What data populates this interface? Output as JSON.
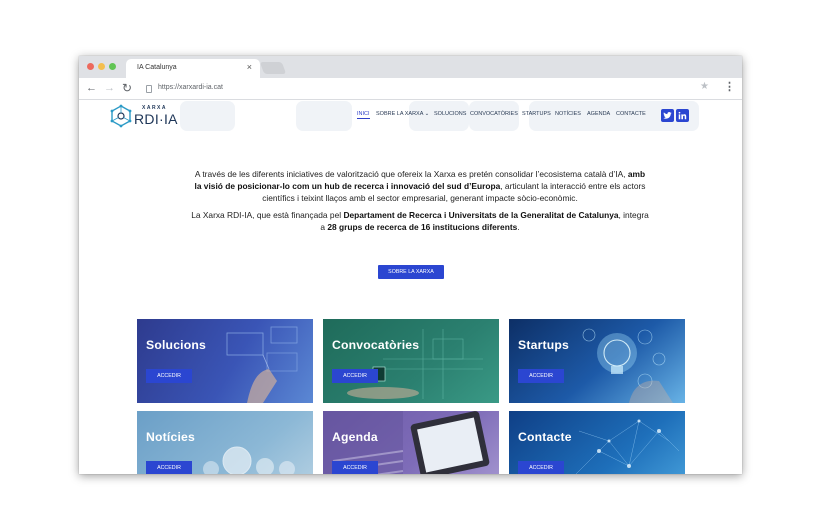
{
  "browser": {
    "tab_title": "IA Catalunya",
    "tab_close": "×",
    "url": "https://xarxardi-ia.cat",
    "back_icon": "arrow-left-icon",
    "forward_icon": "arrow-right-icon",
    "reload_icon": "reload-icon",
    "star_icon": "star-icon",
    "menu_icon": "kebab-menu-icon",
    "back_glyph": "←",
    "forward_glyph": "→",
    "reload_glyph": "↻",
    "star_glyph": "★",
    "menu_glyph": "⋮"
  },
  "site": {
    "logo": {
      "small": "XARXA",
      "big": "RDI·IA"
    },
    "nav": {
      "items": [
        {
          "label": "Inici",
          "active": true
        },
        {
          "label": "Sobre la Xarxa ⌄",
          "active": false
        },
        {
          "label": "Solucions",
          "active": false
        },
        {
          "label": "Convocatòries",
          "active": false
        },
        {
          "label": "Startups",
          "active": false
        },
        {
          "label": "Notícies",
          "active": false
        },
        {
          "label": "Agenda",
          "active": false
        },
        {
          "label": "Contacte",
          "active": false
        }
      ],
      "social": [
        "twitter-icon",
        "linkedin-icon"
      ]
    },
    "intro": {
      "p1_a": "A través de les diferents iniciatives de valorització que ofereix la Xarxa es pretén consolidar l’ecosistema català d’IA, ",
      "p1_b": "amb la visió de posicionar-lo com un hub de recerca i innovació del sud d’Europa",
      "p1_c": ", articulant la interacció entre els actors científics i teixint llaços amb el sector empresarial, generant impacte sòcio-econòmic.",
      "p2_a": "La Xarxa RDI-IA, que està finançada pel ",
      "p2_b": "Departament de Recerca i Universitats de la Generalitat de Catalunya",
      "p2_c": ", integra a ",
      "p2_d": "28 grups de recerca de 16 institucions diferents",
      "p2_e": "."
    },
    "about_button": "Sobre la Xarxa",
    "cards": [
      {
        "title": "Solucions",
        "button": "Accedir"
      },
      {
        "title": "Convocatòries",
        "button": "Accedir"
      },
      {
        "title": "Startups",
        "button": "Accedir"
      },
      {
        "title": "Notícies",
        "button": "Accedir"
      },
      {
        "title": "Agenda",
        "button": "Accedir"
      },
      {
        "title": "Contacte",
        "button": "Accedir"
      }
    ],
    "colors": {
      "accent": "#2b46d1",
      "logo_navy": "#1d3557"
    }
  }
}
